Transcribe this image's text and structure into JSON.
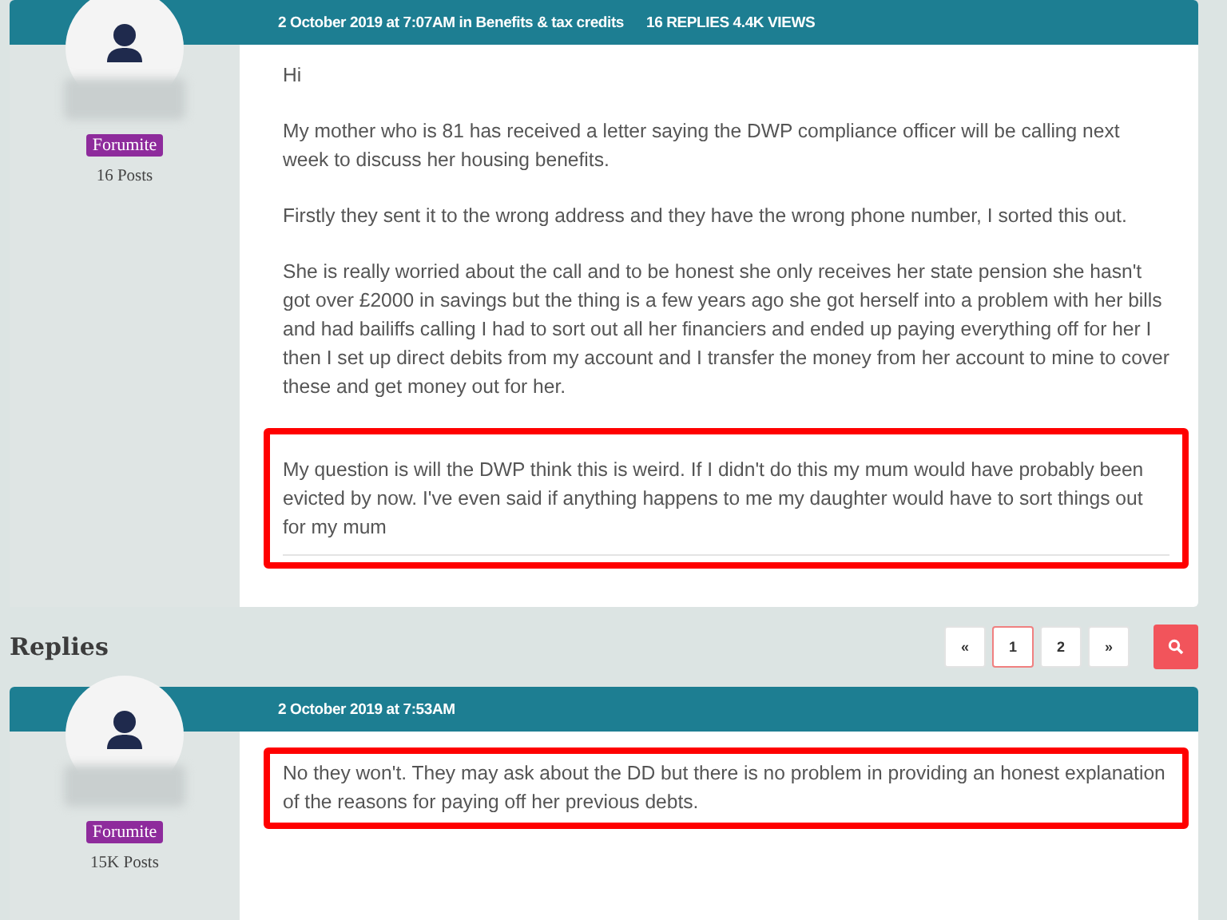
{
  "post": {
    "meta": "2 October 2019 at 7:07AM in Benefits & tax credits",
    "stats": "16 REPLIES 4.4K VIEWS",
    "author": {
      "role": "Forumite",
      "posts": "16 Posts"
    },
    "paragraphs": [
      {
        "text": "Hi",
        "highlighted": false
      },
      {
        "text": "My mother who is 81 has received a letter saying the DWP compliance officer will be calling next week to discuss her housing benefits.",
        "highlighted": false
      },
      {
        "text": "Firstly they sent it to the wrong address and they have the wrong phone number, I sorted this out.",
        "highlighted": false
      },
      {
        "text": "She is really worried about the call and to be honest she only receives her state pension she hasn't got over £2000 in savings but the thing is a few years ago she got herself into a problem with her bills and had bailiffs calling I had to sort out all her financiers and ended up paying everything off for her I then I set up direct debits from my account and I transfer the money from her account to mine to cover these and get money out for her.",
        "highlighted": false
      },
      {
        "text": "My question is will the DWP think this is weird. If I didn't do this my mum would have probably been evicted by now. I've even said if anything happens to me my daughter would have to sort things out for my mum",
        "highlighted": true
      }
    ]
  },
  "replies_heading": "Replies",
  "pagination": [
    {
      "label": "«",
      "selected": false
    },
    {
      "label": "1",
      "selected": true
    },
    {
      "label": "2",
      "selected": false
    },
    {
      "label": "»",
      "selected": false
    }
  ],
  "reply": {
    "meta": "2 October 2019 at 7:53AM",
    "author": {
      "role": "Forumite",
      "posts": "15K Posts"
    },
    "paragraphs": [
      {
        "text": "No they won't. They may ask about the DD but there is no problem in providing an honest explanation of the reasons for paying off her previous debts.",
        "highlighted": true
      }
    ]
  }
}
